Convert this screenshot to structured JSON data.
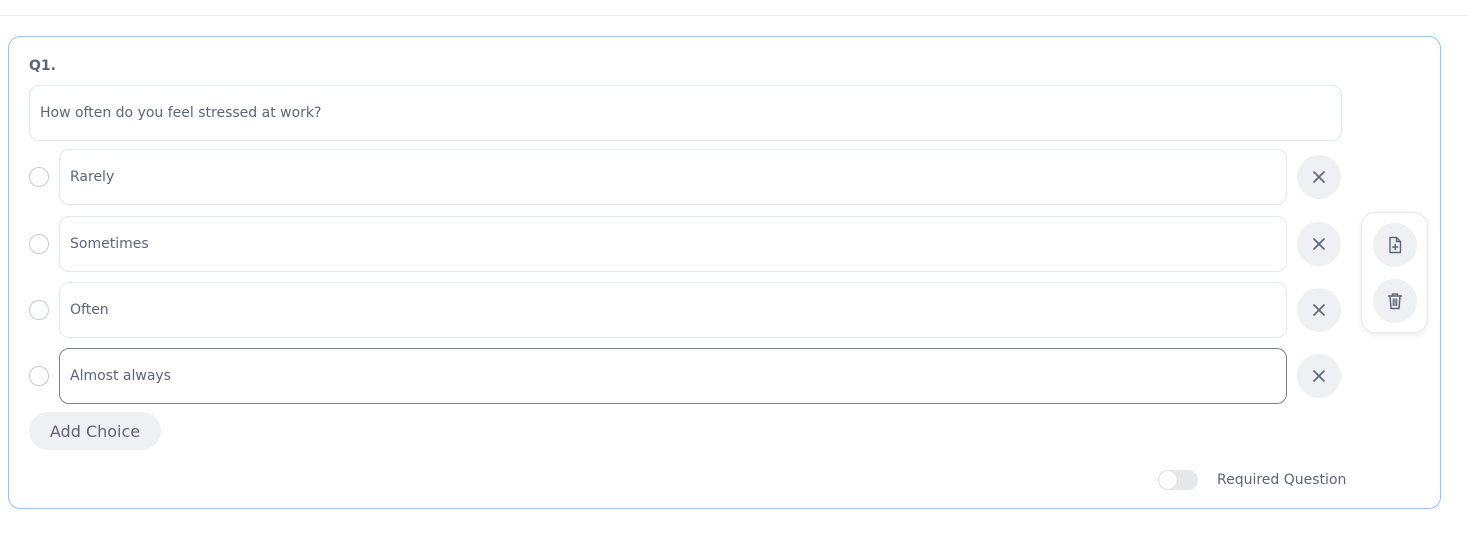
{
  "question": {
    "number": "Q1.",
    "text": "How often do you feel stressed at work?"
  },
  "choices": [
    {
      "value": "Rarely"
    },
    {
      "value": "Sometimes"
    },
    {
      "value": "Often"
    },
    {
      "value": "Almost always"
    }
  ],
  "actions": {
    "add_choice_label": "Add Choice",
    "required_label": "Required Question"
  },
  "icons": {
    "remove": "close-icon",
    "duplicate": "file-plus-icon",
    "delete": "trash-icon"
  },
  "colors": {
    "card_border": "#9ec4ec",
    "button_bg": "#eef0f3",
    "text": "#5b6678"
  }
}
